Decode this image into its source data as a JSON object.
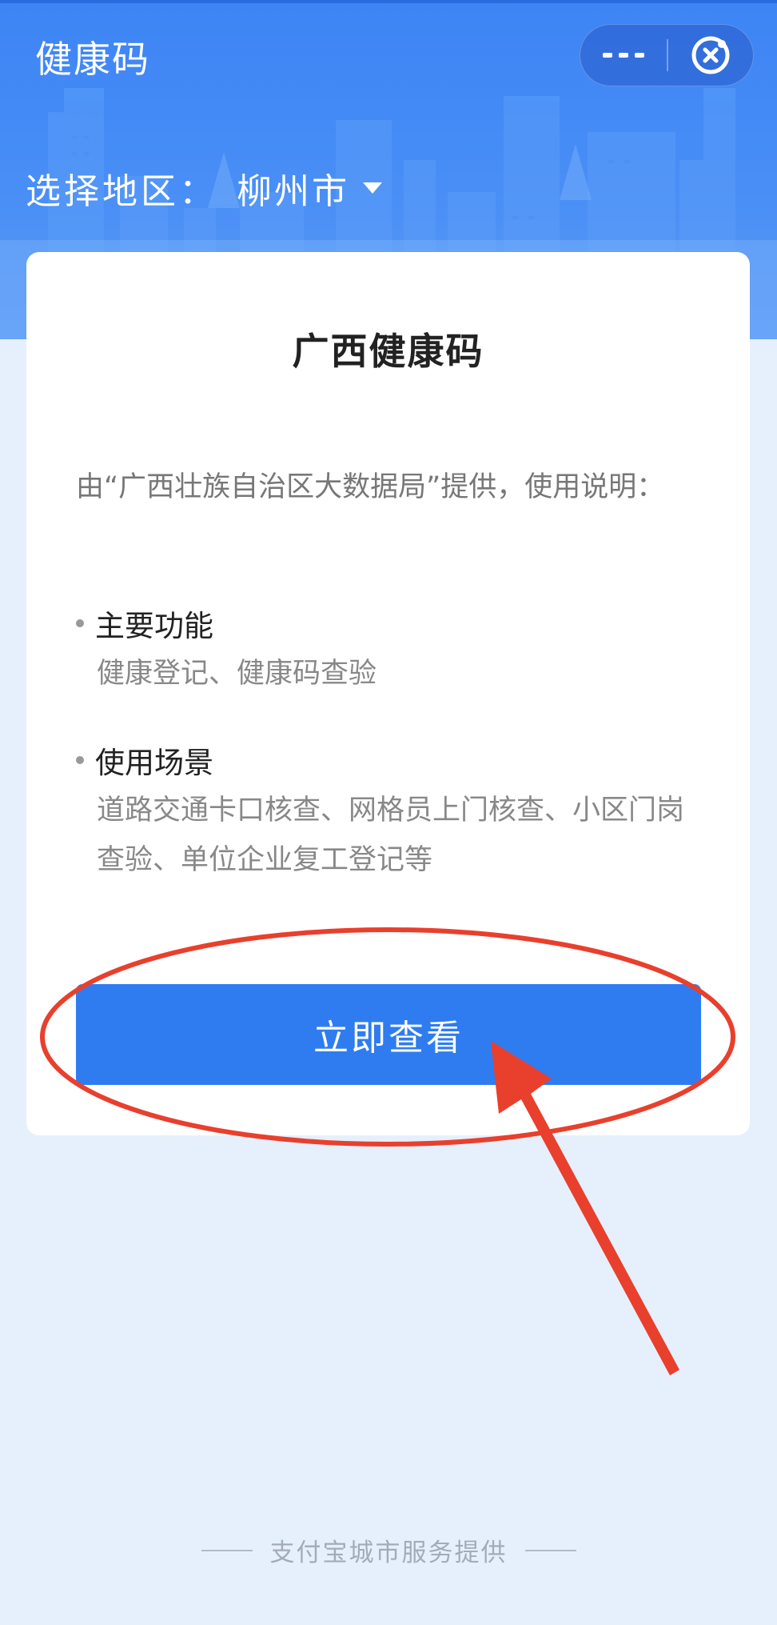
{
  "header": {
    "app_title": "健康码",
    "region_label": "选择地区：",
    "region_value": "柳州市"
  },
  "card": {
    "title": "广西健康码",
    "description": "由“广西壮族自治区大数据局”提供，使用说明：",
    "sections": [
      {
        "heading": "主要功能",
        "body": "健康登记、健康码查验"
      },
      {
        "heading": "使用场景",
        "body": "道路交通卡口核查、网格员上门核查、小区门岗查验、单位企业复工登记等"
      }
    ],
    "button_label": "立即查看"
  },
  "footer": {
    "text": "支付宝城市服务提供"
  },
  "colors": {
    "header_blue": "#3d84f5",
    "button_blue": "#2f7cf1",
    "annotation_red": "#e8402d",
    "page_bg": "#e6f0fd"
  },
  "icons": [
    "more-dots-icon",
    "close-circle-icon",
    "caret-down-icon",
    "annotation-circle",
    "annotation-arrow"
  ]
}
